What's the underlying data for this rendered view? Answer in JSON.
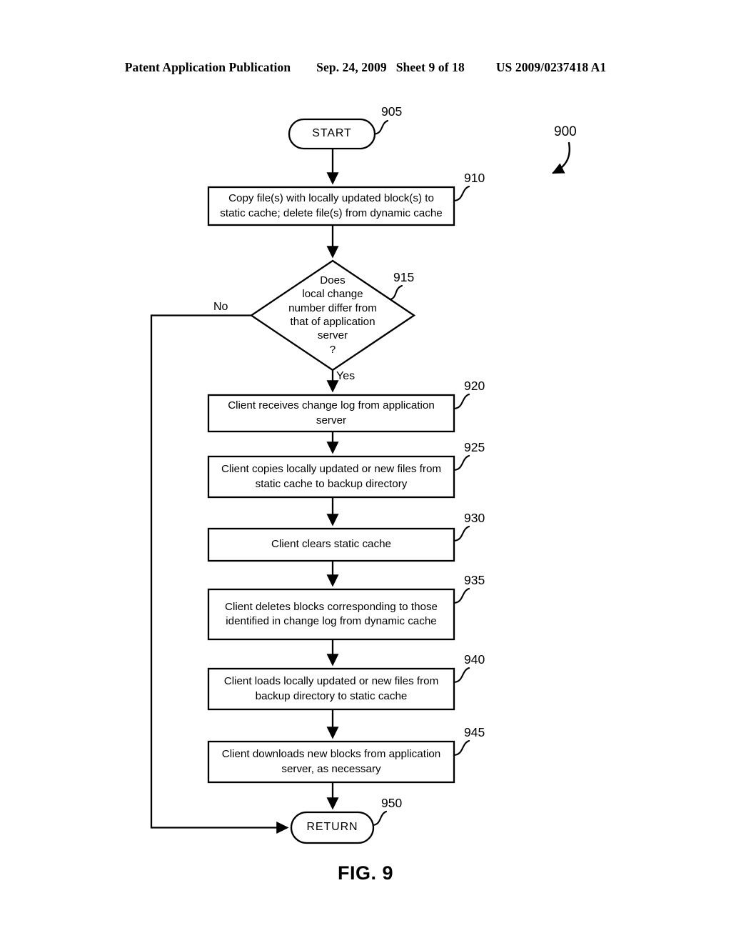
{
  "header": {
    "publication": "Patent Application Publication",
    "date": "Sep. 24, 2009",
    "sheet": "Sheet 9 of 18",
    "patent_number": "US 2009/0237418 A1"
  },
  "figure": {
    "caption": "FIG. 9",
    "diagram_ref": "900"
  },
  "flowchart": {
    "nodes": [
      {
        "id": "start",
        "ref": "905",
        "shape": "terminal",
        "text": "START"
      },
      {
        "id": "step910",
        "ref": "910",
        "shape": "process",
        "text": "Copy file(s) with locally updated block(s) to\nstatic cache; delete file(s) from dynamic cache"
      },
      {
        "id": "dec915",
        "ref": "915",
        "shape": "decision",
        "text": "Does\nlocal change\nnumber differ from\nthat of application\nserver\n?"
      },
      {
        "id": "step920",
        "ref": "920",
        "shape": "process",
        "text": "Client receives change log from application\nserver"
      },
      {
        "id": "step925",
        "ref": "925",
        "shape": "process",
        "text": "Client copies locally updated or new files from\nstatic cache to backup directory"
      },
      {
        "id": "step930",
        "ref": "930",
        "shape": "process",
        "text": "Client clears static cache"
      },
      {
        "id": "step935",
        "ref": "935",
        "shape": "process",
        "text": "Client deletes blocks corresponding to those\nidentified in change log from dynamic cache"
      },
      {
        "id": "step940",
        "ref": "940",
        "shape": "process",
        "text": "Client loads locally updated or new files from\nbackup directory to static cache"
      },
      {
        "id": "step945",
        "ref": "945",
        "shape": "process",
        "text": "Client downloads new blocks from application\nserver, as necessary"
      },
      {
        "id": "return",
        "ref": "950",
        "shape": "terminal",
        "text": "RETURN"
      }
    ],
    "branch_labels": {
      "no": "No",
      "yes": "Yes"
    }
  }
}
